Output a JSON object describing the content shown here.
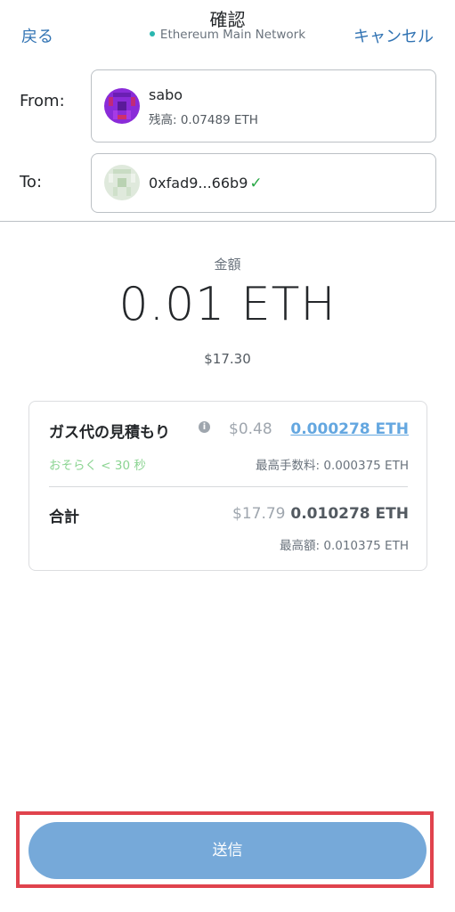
{
  "header": {
    "back_label": "戻る",
    "title": "確認",
    "network": "Ethereum Main Network",
    "cancel_label": "キャンセル",
    "network_dot_color": "#29b6af"
  },
  "from": {
    "label": "From:",
    "account_name": "sabo",
    "balance": "残高: 0.07489 ETH",
    "avatar_icon": "identicon-purple"
  },
  "to": {
    "label": "To:",
    "address": "0xfad9...66b9",
    "check_icon": "✓",
    "avatar_icon": "identicon-light-green"
  },
  "amount": {
    "label": "金額",
    "value": "0.01 ETH",
    "fiat": "$17.30"
  },
  "gas": {
    "title": "ガス代の見積もり",
    "info_icon": "i",
    "fiat": "$0.48",
    "eth": "0.000278 ETH",
    "time": "おそらく < 30 秒",
    "max_fee": "最高手数料: 0.000375 ETH"
  },
  "total": {
    "title": "合計",
    "fiat": "$17.79",
    "eth": "0.010278 ETH",
    "max_amount": "最高額: 0.010375 ETH"
  },
  "send_button": {
    "label": "送信",
    "color": "#76a9d9"
  },
  "highlight_color": "#e0434d"
}
